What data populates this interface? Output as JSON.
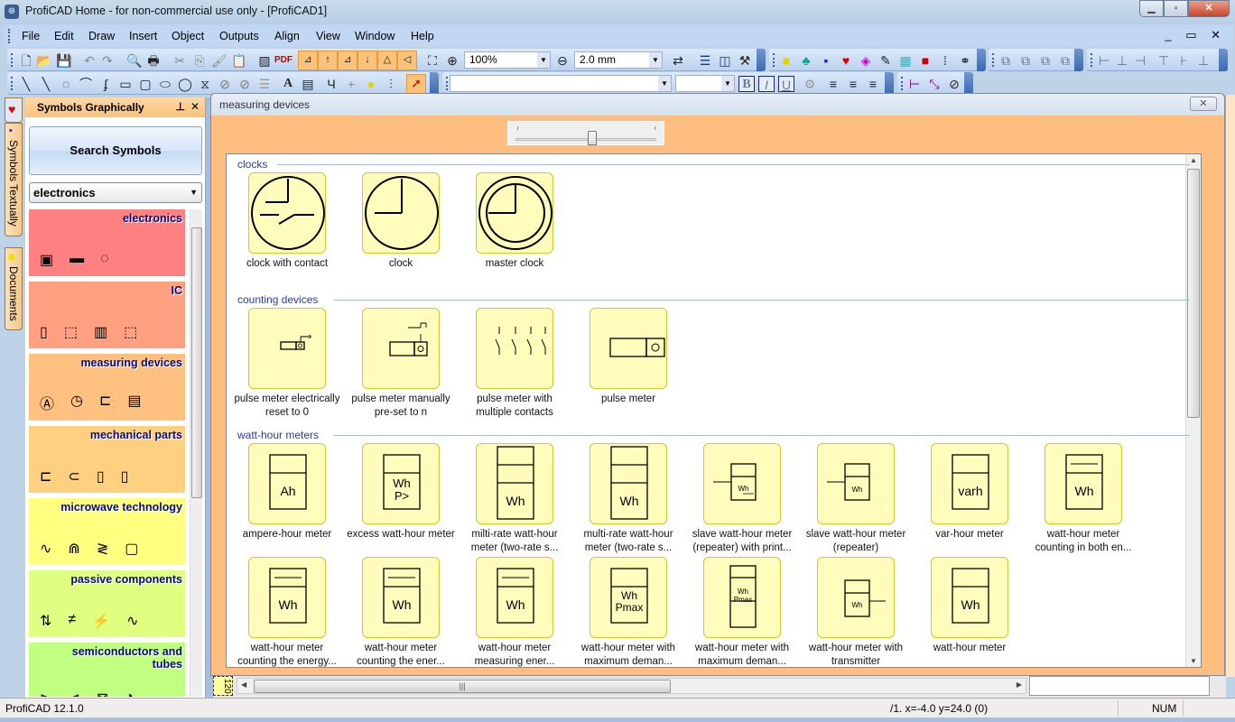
{
  "window": {
    "title": "ProfiCAD Home - for non-commercial use only - [ProfiCAD1]",
    "controls": {
      "minimize": "▁",
      "maximize": "▫",
      "close": "✕"
    }
  },
  "menubar": {
    "items": [
      "File",
      "Edit",
      "Draw",
      "Insert",
      "Object",
      "Outputs",
      "Align",
      "View",
      "Window",
      "Help"
    ],
    "mdi_controls": "_ ▭ ✕"
  },
  "toolbar": {
    "zoom_value": "100%",
    "grid_value": "2.0 mm",
    "font_value": "",
    "size_value": "",
    "bold": "B",
    "italic": "I",
    "underline": "U"
  },
  "vertical_tabs": [
    {
      "label": "",
      "icon": "heart-icon"
    },
    {
      "label": "Symbols Textually",
      "icon": "tree-icon"
    },
    {
      "label": "Documents",
      "icon": "folder-icon"
    }
  ],
  "left_panel": {
    "title": "Symbols Graphically",
    "pin": "⊥",
    "close": "✕",
    "search_button": "Search Symbols",
    "category_select": "electronics",
    "categories": [
      {
        "name": "electronics",
        "color": "#ff8080",
        "icons": [
          "▣",
          "▬",
          "◌"
        ]
      },
      {
        "name": "IC",
        "color": "#ffa080",
        "icons": [
          "▯",
          "⬚",
          "▥",
          "⬚"
        ]
      },
      {
        "name": "measuring devices",
        "color": "#ffc080",
        "icons": [
          "Ⓐ",
          "◷",
          "⊏",
          "▤"
        ]
      },
      {
        "name": "mechanical parts",
        "color": "#ffd080",
        "icons": [
          "⊏",
          "⊂",
          "▯",
          "▯"
        ]
      },
      {
        "name": "microwave technology",
        "color": "#ffff80",
        "icons": [
          "∿",
          "⋒",
          "≷",
          "▢"
        ]
      },
      {
        "name": "passive components",
        "color": "#e0ff80",
        "icons": [
          "⇅",
          "≠",
          "⚡",
          "∿"
        ]
      },
      {
        "name": "semiconductors and tubes",
        "color": "#c0ff80",
        "icons": [
          "⊳",
          "⊲",
          "⊠",
          "◔"
        ]
      }
    ]
  },
  "child_window": {
    "title": "measuring devices",
    "close": "✕",
    "zoom_slider": {
      "value_fraction": 0.55
    },
    "sections": [
      {
        "name": "clocks",
        "symbols": [
          {
            "label": "clock with contact"
          },
          {
            "label": "clock"
          },
          {
            "label": "master clock"
          }
        ]
      },
      {
        "name": "counting devices",
        "symbols": [
          {
            "label": "pulse meter electrically reset to 0"
          },
          {
            "label": "pulse meter manually pre-set to n"
          },
          {
            "label": "pulse meter with multiple contacts"
          },
          {
            "label": "pulse meter"
          }
        ]
      },
      {
        "name": "watt-hour meters",
        "symbols": [
          {
            "label": "ampere-hour meter",
            "text": "Ah"
          },
          {
            "label": "excess watt-hour meter",
            "text": "Wh P>"
          },
          {
            "label": "milti-rate watt-hour meter (two-rate s...",
            "text": "Wh"
          },
          {
            "label": "multi-rate watt-hour meter (two-rate s...",
            "text": "Wh"
          },
          {
            "label": "slave watt-hour meter (repeater) with print...",
            "text": "Wh"
          },
          {
            "label": "slave watt-hour meter (repeater)",
            "text": "Wh"
          },
          {
            "label": "var-hour meter",
            "text": "varh"
          },
          {
            "label": "watt-hour meter counting in both en...",
            "text": "Wh"
          },
          {
            "label": "watt-hour meter counting the energy...",
            "text": "Wh"
          },
          {
            "label": "watt-hour meter counting the ener...",
            "text": "Wh"
          },
          {
            "label": "watt-hour meter measuring ener...",
            "text": "Wh"
          },
          {
            "label": "watt-hour meter with maximum deman...",
            "text": "Wh Pmax"
          },
          {
            "label": "watt-hour meter with maximum deman...",
            "text": "Wh Pmax"
          },
          {
            "label": "watt-hour meter with transmitter",
            "text": "Wh"
          },
          {
            "label": "watt-hour meter",
            "text": "Wh"
          }
        ]
      }
    ]
  },
  "ruler_label": "120",
  "statusbar": {
    "version": "ProfiCAD 12.1.0",
    "coords": "/1.  x=-4.0  y=24.0 (0)",
    "num": "NUM"
  }
}
